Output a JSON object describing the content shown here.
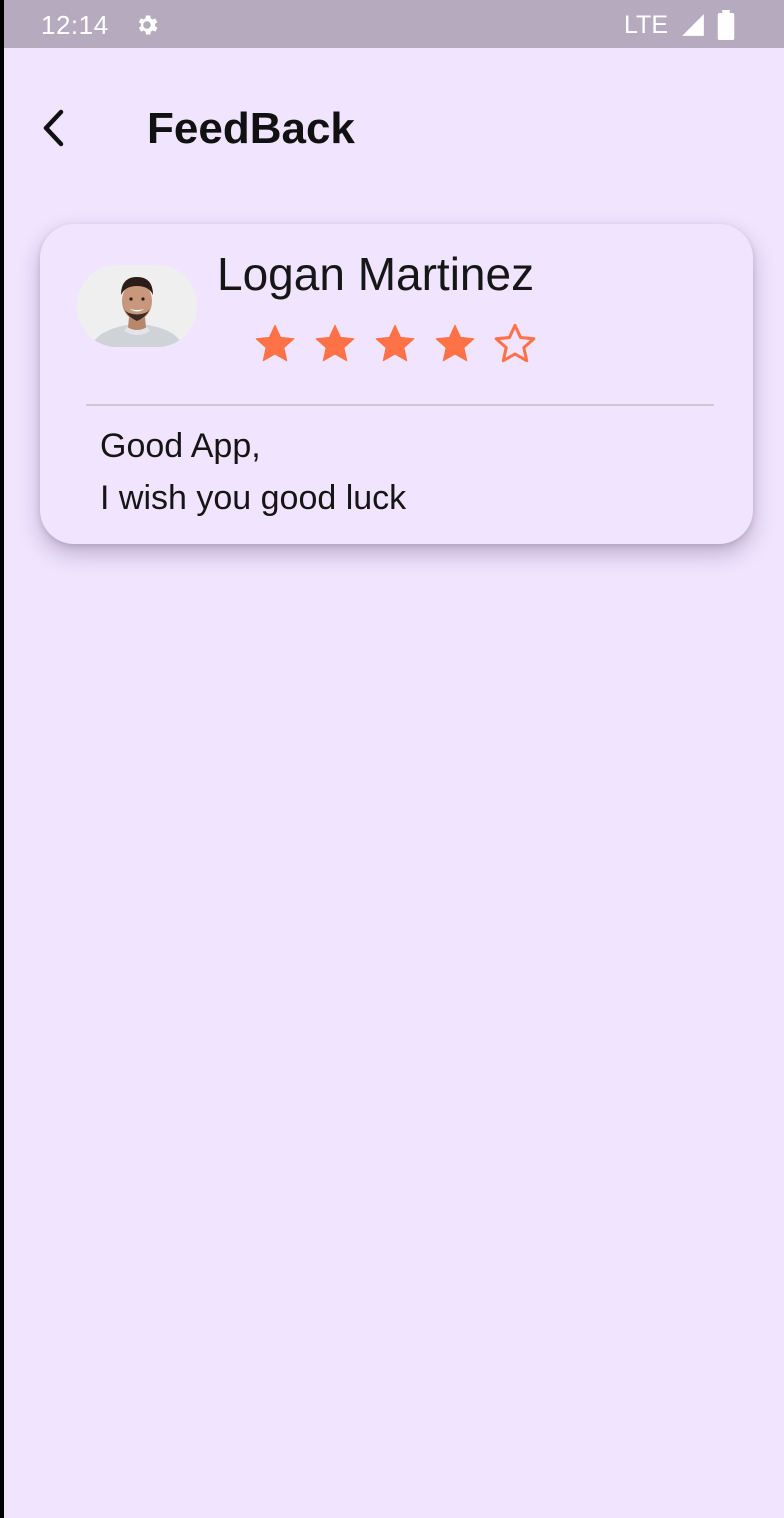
{
  "status_bar": {
    "time": "12:14",
    "network": "LTE",
    "icons": [
      "gear-icon",
      "signal-icon",
      "battery-icon"
    ],
    "color": "#b6abbe"
  },
  "app_bar": {
    "title": "FeedBack",
    "back_icon": "chevron-left-icon"
  },
  "feedback": {
    "name": "Logan Martinez",
    "rating": 4,
    "max_rating": 5,
    "star_color": "#ff7248",
    "review_lines": [
      "Good App,",
      "I wish you good luck"
    ]
  },
  "colors": {
    "background": "#f1e4ff",
    "card": "#f0e4fe"
  }
}
